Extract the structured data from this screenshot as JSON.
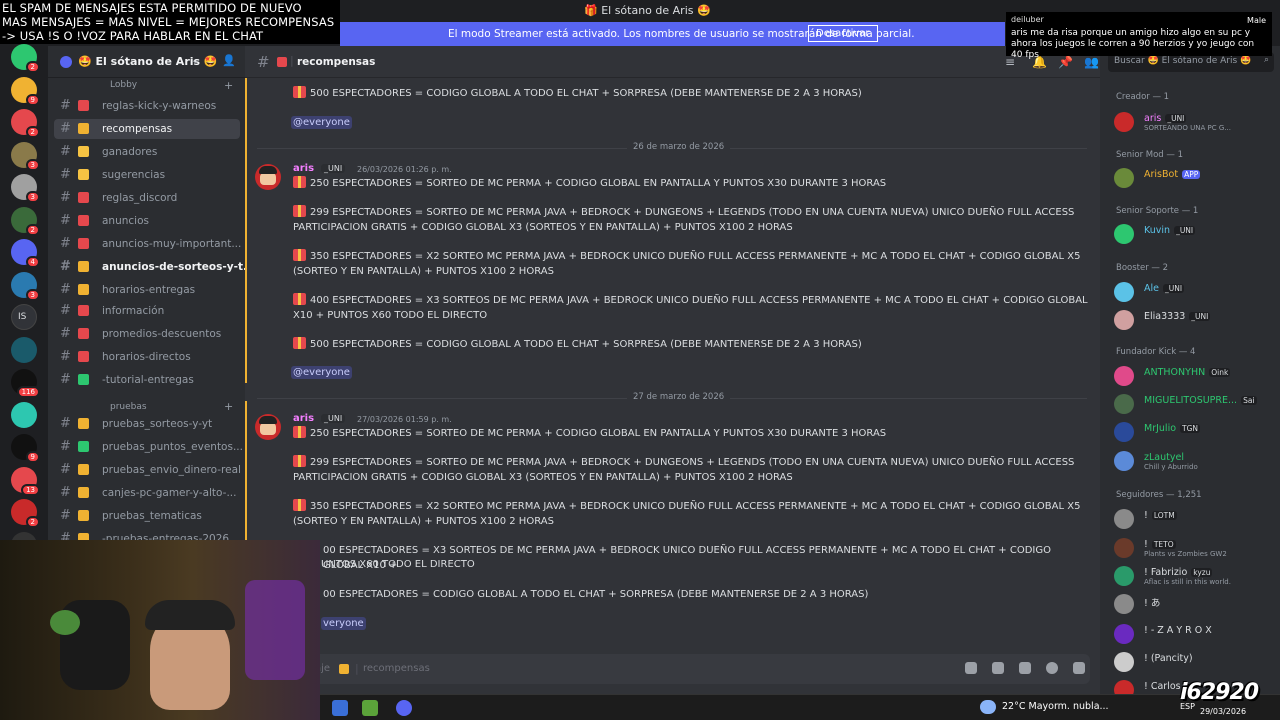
{
  "window": {
    "title": "🎁 El sótano de Aris 🤩"
  },
  "banner": {
    "message": "El modo Streamer está activado. Los nombres de usuario se mostrarán de forma parcial.",
    "button": "Desactivar"
  },
  "overlay_top_left": {
    "lines": [
      "EL SPAM DE MENSAJES ESTA PERMITIDO DE NUEVO",
      "MAS MENSAJES = MAS NIVEL = MEJORES RECOMPENSAS",
      "-> USA !S  O !VOZ PARA HABLAR EN EL CHAT"
    ]
  },
  "overlay_chat": {
    "user": "deiluber",
    "right_name": "Male",
    "message": "aris me da risa porque un amigo hizo algo en su pc y ahora los juegos le corren a 90 herzios y yo jeugo con 40 fps"
  },
  "server": {
    "name": "🤩 El sótano de Aris 🤩"
  },
  "rail_badges": [
    "2",
    "9",
    "2",
    "3",
    "3",
    "2",
    "4",
    "3",
    "IS",
    "",
    "116",
    "",
    "9",
    "13",
    "2",
    "4"
  ],
  "sidebar": {
    "cat_lobby": "Lobby",
    "cat_pruebas": "pruebas",
    "channels": [
      {
        "label": "reglas-kick-y-warneos"
      },
      {
        "label": "recompensas"
      },
      {
        "label": "ganadores"
      },
      {
        "label": "sugerencias"
      },
      {
        "label": "reglas_discord"
      },
      {
        "label": "anuncios"
      },
      {
        "label": "anuncios-muy-important..."
      },
      {
        "label": "anuncios-de-sorteos-y-t..."
      },
      {
        "label": "horarios-entregas"
      },
      {
        "label": "información"
      },
      {
        "label": "promedios-descuentos"
      },
      {
        "label": "horarios-directos"
      },
      {
        "label": "-tutorial-entregas"
      },
      {
        "label": "pruebas_sorteos-y-yt"
      },
      {
        "label": "pruebas_puntos_eventos..."
      },
      {
        "label": "pruebas_envio_dinero-real"
      },
      {
        "label": "canjes-pc-gamer-y-alto-..."
      },
      {
        "label": "pruebas_tematicas"
      },
      {
        "label": "-pruebas-entregas-2026"
      }
    ]
  },
  "channel": {
    "name": "recompensas",
    "composer_placeholder": "recompensas",
    "composer_prefix": "aje"
  },
  "messages": {
    "top_line": "500 ESPECTADORES = CODIGO GLOBAL A TODO EL CHAT + SORPRESA (DEBE MANTENERSE DE 2 A 3 HORAS)",
    "mention": "@everyone",
    "mention_cut": "veryone",
    "date1": "26 de marzo de 2026",
    "date2": "27 de marzo de 2026",
    "author": "aris",
    "author_tag": "_UNI",
    "time1": "26/03/2026 01:26 p. m.",
    "time2": "27/03/2026 01:59 p. m.",
    "lines": [
      "250 ESPECTADORES = SORTEO DE MC PERMA + CODIGO GLOBAL EN PANTALLA Y PUNTOS X30 DURANTE 3 HORAS",
      "299 ESPECTADORES = SORTEO DE MC PERMA JAVA + BEDROCK + DUNGEONS + LEGENDS (TODO EN UNA CUENTA NUEVA) UNICO DUEÑO FULL ACCESS PARTICIPACION GRATIS + CODIGO GLOBAL X3 (SORTEOS Y EN PANTALLA) + PUNTOS X100 2 HORAS",
      "350 ESPECTADORES = X2 SORTEO MC PERMA JAVA + BEDROCK UNICO DUEÑO FULL ACCESS PERMANENTE + MC A TODO EL CHAT + CODIGO GLOBAL X5 (SORTEO Y EN PANTALLA) + PUNTOS X100 2 HORAS",
      "400 ESPECTADORES = X3 SORTEOS DE MC PERMA JAVA + BEDROCK UNICO DUEÑO FULL ACCESS PERMANENTE + MC  A TODO EL CHAT + CODIGO GLOBAL X10 + PUNTOS X60 TODO EL DIRECTO",
      "500 ESPECTADORES = CODIGO GLOBAL A TODO EL CHAT + SORPRESA (DEBE MANTENERSE DE 2 A 3 HORAS)"
    ],
    "lines2_cut": [
      "00 ESPECTADORES = X3 SORTEOS DE MC PERMA JAVA + BEDROCK UNICO DUEÑO FULL ACCESS PERMANENTE + MC  A TODO EL CHAT + CODIGO GLOBAL X10 +",
      "UNTOS X60 TODO EL DIRECTO",
      "00 ESPECTADORES = CODIGO GLOBAL A TODO EL CHAT + SORPRESA (DEBE MANTENERSE DE 2 A 3 HORAS)"
    ]
  },
  "members": {
    "search": "Buscar 🤩 El sótano de Aris 🤩",
    "cat_creador": "Creador — 1",
    "cat_senior_mod": "Senior Mod — 1",
    "cat_senior_soporte": "Senior Soporte — 1",
    "cat_booster": "Booster — 2",
    "cat_fundador": "Fundador Kick — 4",
    "cat_seguidores": "Seguidores — 1,251",
    "list": [
      {
        "name": "aris",
        "tag": "_UNI",
        "status": "SORTEANDO UNA PC G...",
        "color": "#f47fff"
      },
      {
        "name": "ArisBot",
        "tag": "APP",
        "status": "",
        "color": "#f0b232"
      },
      {
        "name": "Kuvin",
        "tag": "_UNI",
        "status": "",
        "color": "#5bc2e7"
      },
      {
        "name": "Ale",
        "tag": "_UNI",
        "status": "",
        "color": "#5bc2e7"
      },
      {
        "name": "Elia3333",
        "tag": "_UNI",
        "status": "",
        "color": "#dbdee1"
      },
      {
        "name": "ANTHONYHN",
        "tag": "Oink",
        "status": "",
        "color": "#2dc770"
      },
      {
        "name": "MIGUELITOSUPRE...",
        "tag": "Sai",
        "status": "",
        "color": "#2dc770"
      },
      {
        "name": "MrJulio",
        "tag": "TGN",
        "status": "",
        "color": "#2dc770"
      },
      {
        "name": "zLautyel",
        "tag": "",
        "status": "Chill y Aburrido",
        "color": "#2dc770"
      },
      {
        "name": "!",
        "tag": "LOTM",
        "status": "",
        "color": "#dbdee1"
      },
      {
        "name": "!",
        "tag": "TETO",
        "status": "Plants vs Zombies GW2",
        "color": "#dbdee1"
      },
      {
        "name": "! Fabrizio",
        "tag": "kyzu",
        "status": "Aflac is still in this world.",
        "color": "#dbdee1"
      },
      {
        "name": "! あ",
        "tag": "",
        "status": "",
        "color": "#dbdee1"
      },
      {
        "name": "! - Z A Y R O X",
        "tag": "",
        "status": "",
        "color": "#dbdee1"
      },
      {
        "name": "! (Pancity)",
        "tag": "",
        "status": "",
        "color": "#dbdee1"
      },
      {
        "name": "! Carlos",
        "tag": "",
        "status": "",
        "color": "#dbdee1"
      }
    ]
  },
  "taskbar": {
    "weather": "22°C  Mayorm. nubla...",
    "lang": "ESP",
    "date": "29/03/2026"
  },
  "watermark": "i62920"
}
